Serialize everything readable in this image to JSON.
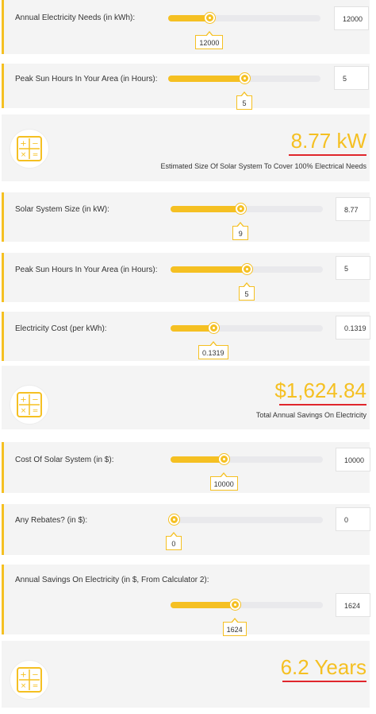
{
  "accent_color": "#f5c022",
  "underline_color": "#e0262c",
  "calculator1": {
    "needs": {
      "label": "Annual Electricity Needs (in kWh):",
      "value": "12000",
      "tooltip": "12000",
      "slider_fraction": 0.27
    },
    "sun": {
      "label": "Peak Sun Hours In Your Area (in Hours):",
      "value": "5",
      "tooltip": "5",
      "slider_fraction": 0.5
    },
    "result": {
      "value": "8.77 kW",
      "caption": "Estimated Size Of Solar System To Cover 100% Electrical Needs",
      "icon": "calculator-icon"
    }
  },
  "calculator2": {
    "size": {
      "label": "Solar System Size (in kW):",
      "value": "8.77",
      "tooltip": "9",
      "slider_fraction": 0.46
    },
    "sun": {
      "label": "Peak Sun Hours In Your Area (in Hours):",
      "value": "5",
      "tooltip": "5",
      "slider_fraction": 0.5
    },
    "cost": {
      "label": "Electricity Cost (per kWh):",
      "value": "0.1319",
      "tooltip": "0.1319",
      "slider_fraction": 0.28
    },
    "result": {
      "value": "$1,624.84",
      "caption": "Total Annual Savings On Electricity",
      "icon": "calculator-icon"
    }
  },
  "calculator3": {
    "cost": {
      "label": "Cost Of Solar System (in $):",
      "value": "10000",
      "tooltip": "10000",
      "slider_fraction": 0.35
    },
    "rebates": {
      "label": "Any Rebates? (in $):",
      "value": "0",
      "tooltip": "0",
      "slider_fraction": 0.02
    },
    "savings": {
      "label": "Annual Savings On Electricity (in $, From Calculator 2):",
      "value": "1624",
      "tooltip": "1624",
      "slider_fraction": 0.42
    },
    "result": {
      "value": "6.2 Years",
      "icon": "calculator-icon"
    }
  }
}
